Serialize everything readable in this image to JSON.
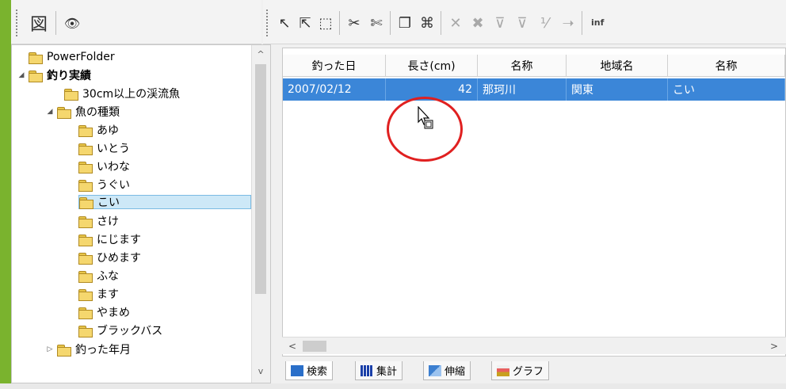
{
  "left_toolbar": {
    "buttons": [
      {
        "icon": "grid-map-icon",
        "glyph": "図"
      },
      {
        "icon": "eye-icon",
        "glyph": "👁"
      }
    ]
  },
  "right_toolbar": {
    "buttons": [
      {
        "icon": "select-arrow-icon",
        "glyph": "↖"
      },
      {
        "icon": "select-all-icon",
        "glyph": "⇱"
      },
      {
        "icon": "select-box-icon",
        "glyph": "⬚"
      },
      {
        "icon": "cut-filter-icon",
        "glyph": "✂"
      },
      {
        "icon": "cut-alt-icon",
        "glyph": "✄"
      },
      {
        "icon": "copy-icon",
        "glyph": "❐"
      },
      {
        "icon": "html-icon",
        "glyph": "⌘"
      },
      {
        "icon": "x-icon",
        "glyph": "✕"
      },
      {
        "icon": "xx-icon",
        "glyph": "✖"
      },
      {
        "icon": "filter-icon",
        "glyph": "⊽"
      },
      {
        "icon": "filter2-icon",
        "glyph": "⊽"
      },
      {
        "icon": "fraction-icon",
        "glyph": "⅟"
      },
      {
        "icon": "arrow-right-icon",
        "glyph": "➝"
      }
    ],
    "inf_label": "inf"
  },
  "tree": {
    "items": [
      {
        "label": "PowerFolder",
        "level": 0,
        "expander": "",
        "bold": false
      },
      {
        "label": "釣り実績",
        "level": 0,
        "expander": "◢",
        "bold": true
      },
      {
        "label": "30cm以上の渓流魚",
        "level": 2,
        "expander": "",
        "bold": false
      },
      {
        "label": "魚の種類",
        "level": 1,
        "expander": "◢",
        "bold": false
      },
      {
        "label": "あゆ",
        "level": 2,
        "expander": "",
        "bold": false
      },
      {
        "label": "いとう",
        "level": 2,
        "expander": "",
        "bold": false
      },
      {
        "label": "いわな",
        "level": 2,
        "expander": "",
        "bold": false
      },
      {
        "label": "うぐい",
        "level": 2,
        "expander": "",
        "bold": false
      },
      {
        "label": "こい",
        "level": 2,
        "expander": "",
        "bold": false,
        "selected": true
      },
      {
        "label": "さけ",
        "level": 2,
        "expander": "",
        "bold": false
      },
      {
        "label": "にじます",
        "level": 2,
        "expander": "",
        "bold": false
      },
      {
        "label": "ひめます",
        "level": 2,
        "expander": "",
        "bold": false
      },
      {
        "label": "ふな",
        "level": 2,
        "expander": "",
        "bold": false
      },
      {
        "label": "ます",
        "level": 2,
        "expander": "",
        "bold": false
      },
      {
        "label": "やまめ",
        "level": 2,
        "expander": "",
        "bold": false
      },
      {
        "label": "ブラックバス",
        "level": 2,
        "expander": "",
        "bold": false
      },
      {
        "label": "釣った年月",
        "level": 1,
        "expander": "▷",
        "bold": false
      }
    ],
    "scroll_up": "^",
    "scroll_down": "v"
  },
  "grid": {
    "columns": [
      "釣った日",
      "長さ(cm)",
      "名称",
      "地域名",
      "名称"
    ],
    "rows": [
      [
        "2007/02/12",
        "42",
        "那珂川",
        "関東",
        "こい"
      ]
    ]
  },
  "hscroll": {
    "left": "<",
    "right": ">"
  },
  "tabs": [
    {
      "label": "検索",
      "icon": "search-tab-icon",
      "color": "#2a6fc9",
      "active": true
    },
    {
      "label": "集計",
      "icon": "aggregate-tab-icon",
      "color": "#1a3fa8",
      "active": false
    },
    {
      "label": "伸縮",
      "icon": "stretch-tab-icon",
      "color": "#3c7fd0",
      "active": false
    },
    {
      "label": "グラフ",
      "icon": "graph-tab-icon",
      "color": "#c8a020",
      "active": false
    }
  ],
  "colors": {
    "accent": "#7ab32e",
    "selection": "#3b86d8",
    "tree_selection": "#cde8f7",
    "highlight_circle": "#e02020"
  }
}
